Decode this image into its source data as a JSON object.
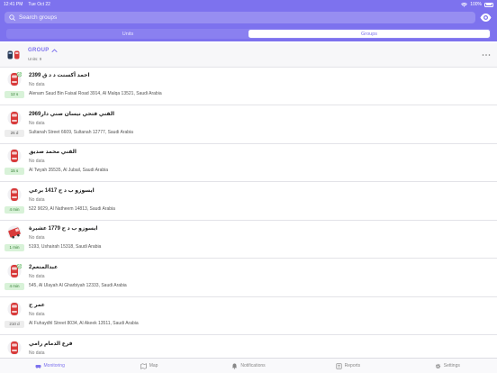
{
  "status_bar": {
    "time": "12:41 PM",
    "date": "Tue Oct 22",
    "battery": "100%"
  },
  "search": {
    "placeholder": "Search groups"
  },
  "segments": {
    "units": "Units",
    "groups": "Groups",
    "selected": "groups"
  },
  "group": {
    "title": "GROUP",
    "subtitle": "Units: 9"
  },
  "units": [
    {
      "name": "احمد أكسنت د د ق 2399",
      "status": "No data",
      "address": "Alenam Saud Bin Faisal Road 3914, Al Malqa 13521, Saudi Arabia",
      "age": "12 s",
      "age_color": "green",
      "icon": "car-icon",
      "has_arrows": true
    },
    {
      "name": "الفني فتحي  نيسان صني  دار2969",
      "status": "No data",
      "address": "Sultanah Street 6609, Sultanah 12777, Saudi Arabia",
      "age": "26 d",
      "age_color": "gray",
      "icon": "car-icon",
      "has_arrows": false
    },
    {
      "name": "الفني محمد صديق",
      "status": "No data",
      "address": "Al Twyah 35535, Al Jubail, Saudi Arabia",
      "age": "15 s",
      "age_color": "green",
      "icon": "car-icon",
      "has_arrows": false
    },
    {
      "name": "ايسوزو ب د ح 1417 برعي",
      "status": "No data",
      "address": "522 9029, Al Natheem 14813, Saudi Arabia",
      "age": "4 min",
      "age_color": "green",
      "icon": "car-icon",
      "has_arrows": false
    },
    {
      "name": "ايسوزو ب د ح 1779 عشيرة",
      "status": "No data",
      "address": "5193, Ushairah 15318, Saudi Arabia",
      "age": "1 min",
      "age_color": "green",
      "icon": "truck-icon",
      "has_arrows": false
    },
    {
      "name": "عبدالمنعم2",
      "status": "No data",
      "address": "545, Al Ulayah Al Gharbiyah 12333, Saudi Arabia",
      "age": "4 min",
      "age_color": "green",
      "icon": "car-icon",
      "has_arrows": true
    },
    {
      "name": "عمر ح",
      "status": "No data",
      "address": "Al Fuhaydhl Street 8034, Al Akeek 13511, Saudi Arabia",
      "age": "210 d",
      "age_color": "gray",
      "icon": "car-icon",
      "has_arrows": false
    },
    {
      "name": "فرع الدمام رامي",
      "status": "No data",
      "address": "",
      "age": "",
      "age_color": "gray",
      "icon": "car-icon",
      "has_arrows": false
    }
  ],
  "tabs": [
    {
      "label": "Monitoring",
      "icon": "monitoring-icon",
      "active": true
    },
    {
      "label": "Map",
      "icon": "map-icon",
      "active": false
    },
    {
      "label": "Notifications",
      "icon": "bell-icon",
      "active": false
    },
    {
      "label": "Reports",
      "icon": "reports-icon",
      "active": false
    },
    {
      "label": "Settings",
      "icon": "gear-icon",
      "active": false
    }
  ],
  "colors": {
    "accent": "#7d72ee",
    "badge_green": "#d8f2d8",
    "car_red": "#d83a3a"
  }
}
